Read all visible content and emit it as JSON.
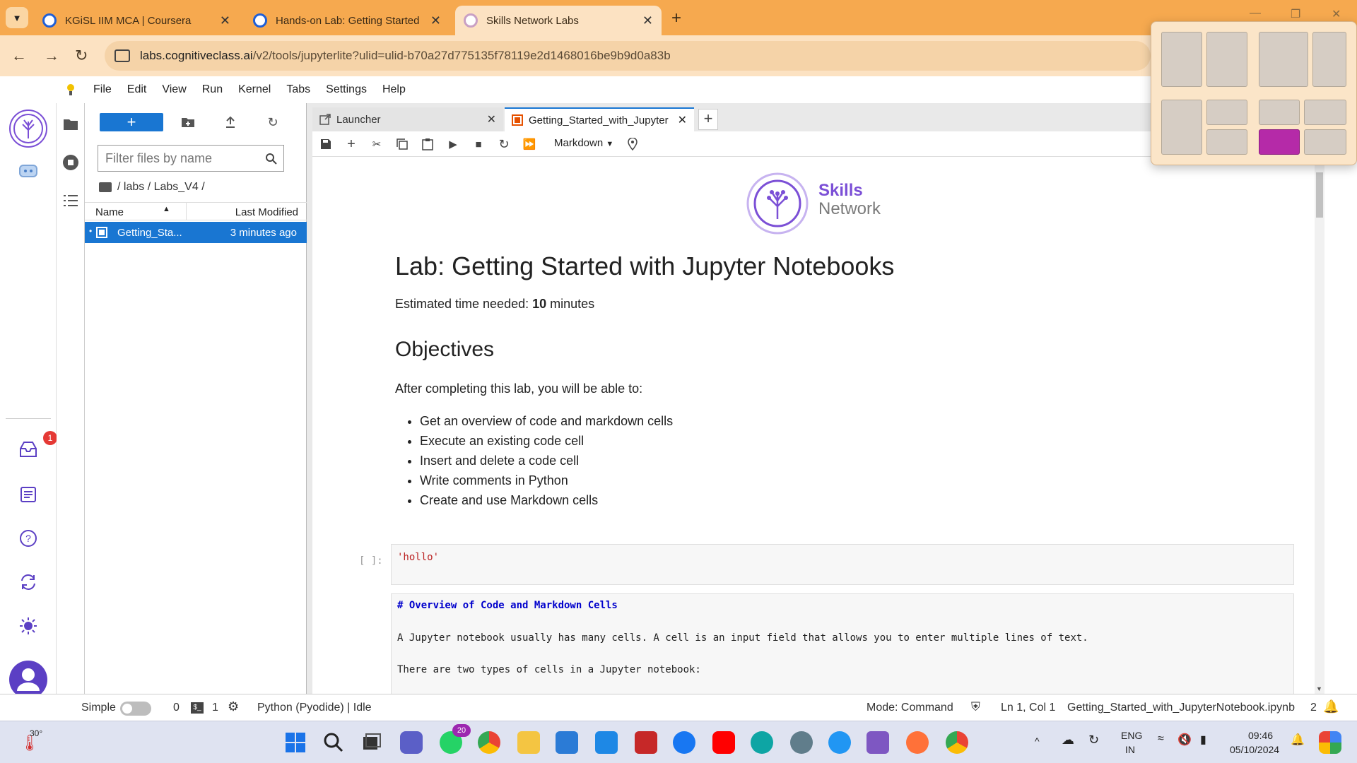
{
  "browser": {
    "tabs": [
      {
        "label": "KGiSL IIM MCA | Coursera"
      },
      {
        "label": "Hands-on Lab: Getting Started"
      },
      {
        "label": "Skills Network Labs"
      }
    ],
    "url_domain": "labs.cognitiveclass.ai",
    "url_path": "/v2/tools/jupyterlite?ulid=ulid-b70a27d775135f78119e2d1468016be9b9d0a83b"
  },
  "menubar": {
    "items": [
      "File",
      "Edit",
      "View",
      "Run",
      "Kernel",
      "Tabs",
      "Settings",
      "Help"
    ]
  },
  "leftbar": {
    "notifications_count": "1"
  },
  "filebrowser": {
    "new_label": "+",
    "filter_placeholder": "Filter files by name",
    "breadcrumb": "/ labs / Labs_V4 /",
    "col_name": "Name",
    "col_modified": "Last Modified",
    "files": [
      {
        "name": "Getting_Sta...",
        "modified": "3 minutes ago"
      }
    ]
  },
  "doctabs": {
    "launcher": "Launcher",
    "notebook": "Getting_Started_with_Jupyter",
    "cell_type": "Markdown"
  },
  "notebook": {
    "brand_line1": "Skills",
    "brand_line2": "Network",
    "title": "Lab: Getting Started with Jupyter Notebooks",
    "time_prefix": "Estimated time needed: ",
    "time_value": "10",
    "time_suffix": " minutes",
    "objectives_heading": "Objectives",
    "objectives_intro": "After completing this lab, you will be able to:",
    "objectives": [
      "Get an overview of code and markdown cells",
      "Execute an existing code cell",
      "Insert and delete a code cell",
      "Write comments in Python",
      "Create and use Markdown cells"
    ],
    "code_prompt": "[ ]:",
    "code_cell": "'hollo'",
    "md_heading": "# Overview of Code and Markdown Cells",
    "md_line1": "A Jupyter notebook usually has many cells. A cell is an input field that allows you to enter multiple lines of text.",
    "md_line2": "There are two types of cells in a Jupyter notebook:"
  },
  "statusbar": {
    "simple": "Simple",
    "zero": "0",
    "one": "1",
    "kernel": "Python (Pyodide) | Idle",
    "mode": "Mode: Command",
    "position": "Ln 1, Col 1",
    "filename": "Getting_Started_with_JupyterNotebook.ipynb",
    "count": "2"
  },
  "taskbar": {
    "weather": "30°",
    "whatsapp_badge": "20",
    "lang1": "ENG",
    "lang2": "IN",
    "time": "09:46",
    "date": "05/10/2024"
  },
  "colors": {
    "accent": "#1976d2",
    "browser_tab": "#f6a94f",
    "brand_purple": "#7b4fd6",
    "snap_highlight": "#b52aa8"
  }
}
